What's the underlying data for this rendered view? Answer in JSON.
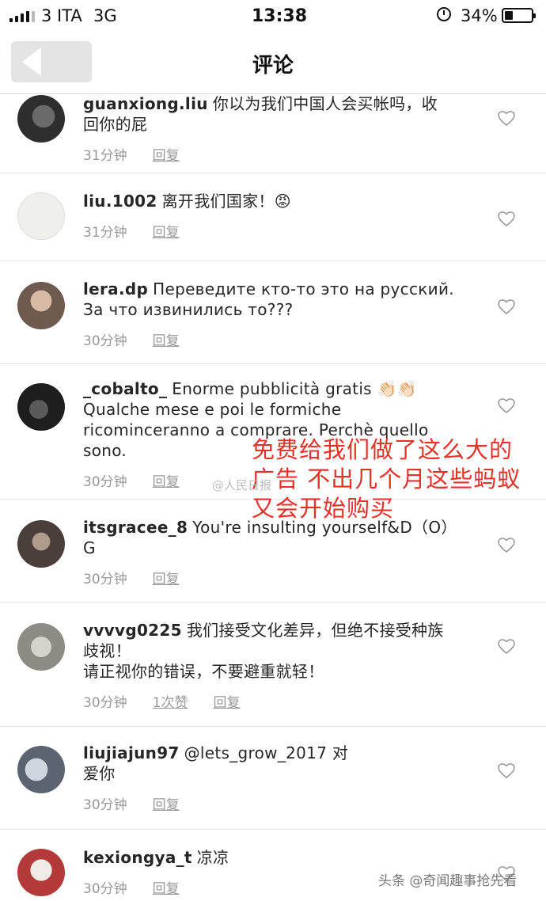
{
  "status": {
    "carrier": "3 ITA",
    "network": "3G",
    "time": "13:38",
    "battery": "34%"
  },
  "header": {
    "title": "评论"
  },
  "comments": [
    {
      "user": "guanxiong.liu",
      "text": "你以为我们中国人会买帐吗，收\n回你的屁",
      "time": "31分钟",
      "likes": "",
      "reply": "回复"
    },
    {
      "user": "liu.1002",
      "text": "离开我们国家！😡",
      "time": "31分钟",
      "likes": "",
      "reply": "回复"
    },
    {
      "user": "lera.dp",
      "text": "Переведите кто-то это на русский.\nЗа что извинились то???",
      "time": "30分钟",
      "likes": "",
      "reply": "回复"
    },
    {
      "user": "_cobalto_",
      "text": "Enorme pubblicità gratis 👏🏻👏🏻\nQualche mese e poi le formiche\nricominceranno a comprare. Perchè quello\nsono.",
      "time": "30分钟",
      "likes": "",
      "reply": "回复"
    },
    {
      "user": "itsgracee_8",
      "text": "You're insulting yourself&D（O）\nG",
      "time": "30分钟",
      "likes": "",
      "reply": "回复"
    },
    {
      "user": "vvvvg0225",
      "text": "我们接受文化差异，但绝不接受种族\n歧视！\n请正视你的错误，不要避重就轻！",
      "time": "30分钟",
      "likes": "1次赞",
      "reply": "回复"
    },
    {
      "user": "liujiajun97",
      "text": "@lets_grow_2017 对\n爱你",
      "time": "30分钟",
      "likes": "",
      "reply": "回复"
    },
    {
      "user": "kexiongya_t",
      "text": "凉凉",
      "time": "30分钟",
      "likes": "",
      "reply": "回复"
    }
  ],
  "annotation": "免费给我们做了这么大的\n广告 不出几个月这些蚂蚁\n又会开始购买",
  "watermarks": {
    "weibo": "@人民日报",
    "toutiao": "头条 @奇闻趣事抢先看"
  },
  "colors": {
    "annotation": "#e8302a",
    "meta": "#999999",
    "divider": "#e4e4e4"
  }
}
